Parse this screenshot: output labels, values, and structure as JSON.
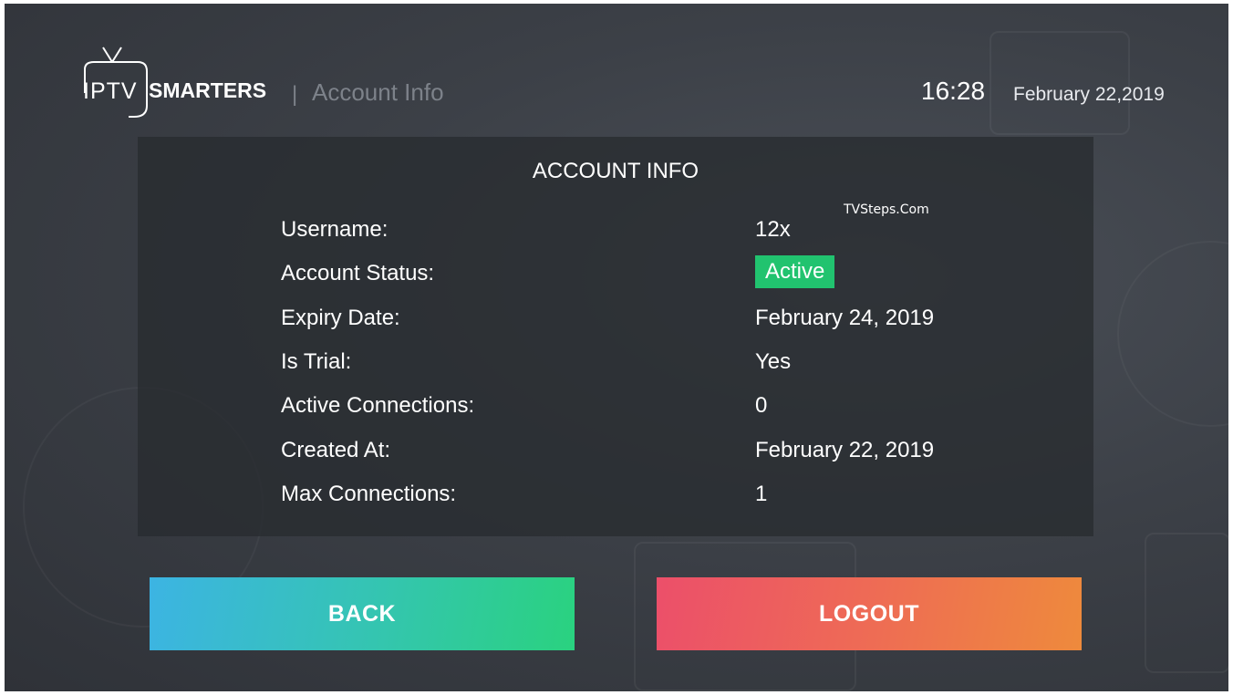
{
  "header": {
    "logo_iptv": "IPTV",
    "logo_smarters": "SMARTERS",
    "separator": "|",
    "title": "Account Info",
    "time": "16:28",
    "date": "February 22,2019"
  },
  "panel": {
    "title": "ACCOUNT INFO",
    "watermark": "TVSteps.Com",
    "rows": [
      {
        "label": "Username:",
        "value": "12x"
      },
      {
        "label": "Account Status:",
        "value": "Active"
      },
      {
        "label": "Expiry Date:",
        "value": "February 24, 2019"
      },
      {
        "label": "Is Trial:",
        "value": "Yes"
      },
      {
        "label": "Active Connections:",
        "value": "0"
      },
      {
        "label": "Created At:",
        "value": "February 22, 2019"
      },
      {
        "label": "Max Connections:",
        "value": "1"
      }
    ]
  },
  "buttons": {
    "back": "BACK",
    "logout": "LOGOUT"
  },
  "colors": {
    "status_active": "#21c36f",
    "back_gradient_start": "#3cb4e3",
    "back_gradient_end": "#2ad27f",
    "logout_gradient_start": "#ec4f6a",
    "logout_gradient_end": "#ee8a3c",
    "background": "#3c4047"
  },
  "icons": {
    "logo": "tv-antenna-logo-icon"
  }
}
